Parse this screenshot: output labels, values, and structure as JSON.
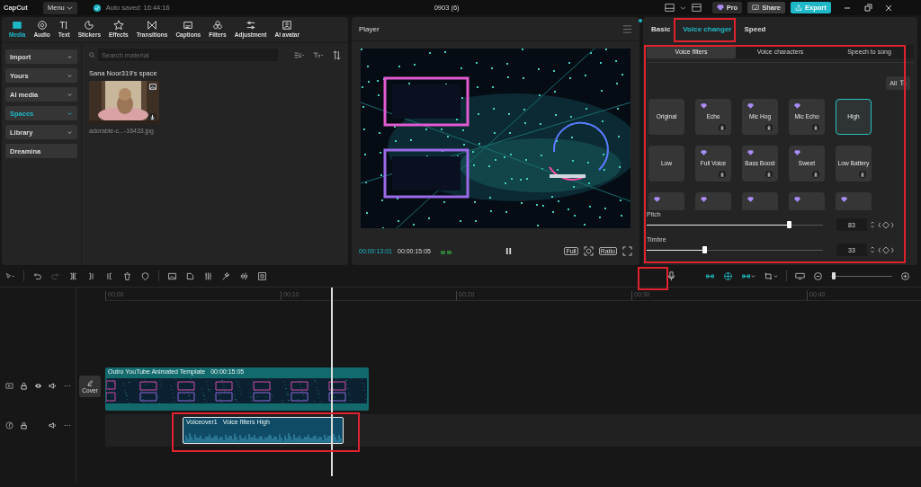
{
  "app": {
    "name": "CapCut",
    "menu": "Menu",
    "autosave": "Auto saved: 16:44:16",
    "project": "0903 (6)",
    "pro": "Pro",
    "share": "Share",
    "export": "Export"
  },
  "media_tabs": [
    {
      "label": "Media",
      "selected": true
    },
    {
      "label": "Audio",
      "selected": false
    },
    {
      "label": "Text",
      "selected": false
    },
    {
      "label": "Stickers",
      "selected": false
    },
    {
      "label": "Effects",
      "selected": false
    },
    {
      "label": "Transitions",
      "selected": false
    },
    {
      "label": "Captions",
      "selected": false
    },
    {
      "label": "Filters",
      "selected": false
    },
    {
      "label": "Adjustment",
      "selected": false
    },
    {
      "label": "AI avatar",
      "selected": false
    }
  ],
  "sidebar": [
    {
      "label": "Import",
      "selected": false,
      "dropdown": true
    },
    {
      "label": "Yours",
      "selected": false,
      "dropdown": true
    },
    {
      "label": "AI media",
      "selected": false,
      "dropdown": true
    },
    {
      "label": "Spaces",
      "selected": true,
      "dropdown": true
    },
    {
      "label": "Library",
      "selected": false,
      "dropdown": true
    },
    {
      "label": "Dreamina",
      "selected": false,
      "dropdown": false
    }
  ],
  "search": {
    "placeholder": "Search material"
  },
  "space_title": "Sana Noor319's space",
  "media_items": [
    {
      "name": "adorable-c...-16433.jpg",
      "kind": "picture"
    }
  ],
  "player": {
    "title": "Player",
    "current": "00:00:13:01",
    "duration": "00:00:15:05",
    "buttons": [
      "Full",
      "Ratio"
    ]
  },
  "inspector_tabs": [
    {
      "label": "Basic",
      "selected": false
    },
    {
      "label": "Voice changer",
      "selected": true
    },
    {
      "label": "Speed",
      "selected": false
    }
  ],
  "voice_tabs": [
    {
      "label": "Voice filters",
      "selected": true
    },
    {
      "label": "Voice characters",
      "selected": false
    },
    {
      "label": "Speech to song",
      "selected": false
    }
  ],
  "filter_all": "All",
  "filters": [
    {
      "name": "Original",
      "pro": false,
      "download": false,
      "selected": false
    },
    {
      "name": "Echo",
      "pro": true,
      "download": true,
      "selected": false
    },
    {
      "name": "Mic Hog",
      "pro": true,
      "download": true,
      "selected": false
    },
    {
      "name": "Mic Echo",
      "pro": true,
      "download": true,
      "selected": false
    },
    {
      "name": "High",
      "pro": false,
      "download": false,
      "selected": true
    },
    {
      "name": "Low",
      "pro": false,
      "download": false,
      "selected": false
    },
    {
      "name": "Full Voice",
      "pro": true,
      "download": true,
      "selected": false
    },
    {
      "name": "Bass Boost",
      "pro": true,
      "download": true,
      "selected": false
    },
    {
      "name": "Sweet",
      "pro": true,
      "download": true,
      "selected": false
    },
    {
      "name": "Low Battery",
      "pro": false,
      "download": true,
      "selected": false
    }
  ],
  "more_filters": [
    {
      "pro": true
    },
    {
      "pro": true
    },
    {
      "pro": true
    },
    {
      "pro": true
    },
    {
      "pro": true
    }
  ],
  "sliders": [
    {
      "label": "Pitch",
      "level": 0.82,
      "value": "83"
    },
    {
      "label": "Timbre",
      "level": 0.34,
      "value": "33"
    }
  ],
  "ruler": [
    "00:00",
    "00:10",
    "00:20",
    "00:30",
    "00:40"
  ],
  "cover": "Cover",
  "zoom": {
    "level": 0.08
  },
  "video_clip": {
    "title": "Outro YouTube Animated Template",
    "duration": "00:00:15:05"
  },
  "audio_clip": {
    "name": "Voiceover1",
    "effect": "Voice filters High"
  }
}
